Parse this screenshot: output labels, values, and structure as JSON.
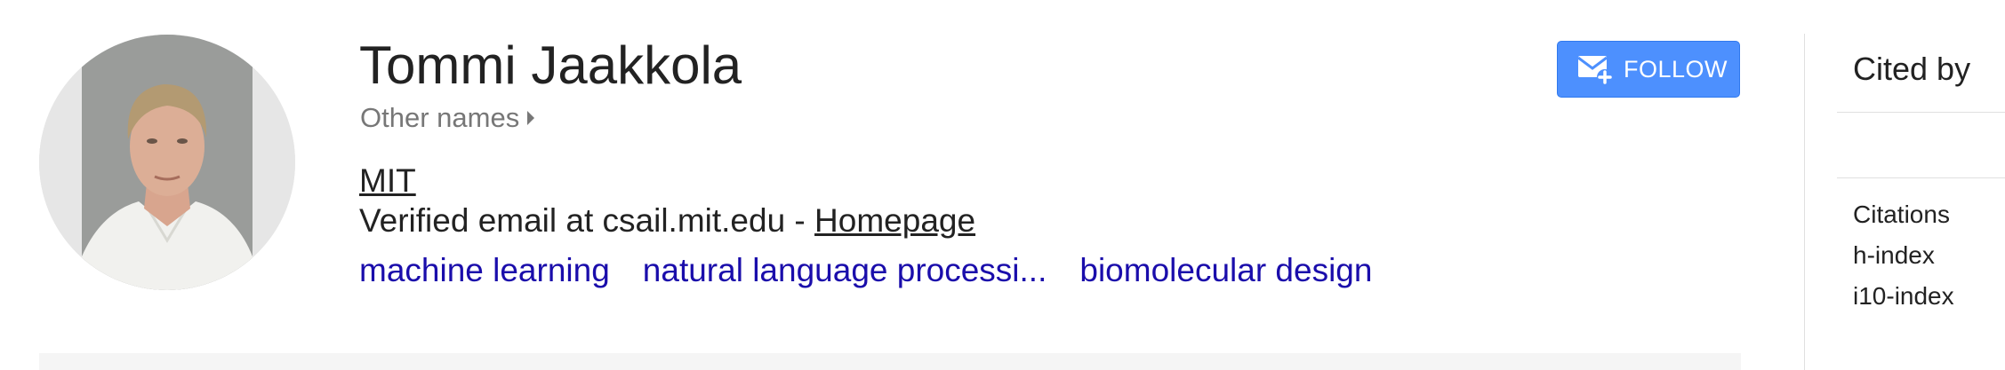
{
  "profile": {
    "name": "Tommi Jaakkola",
    "other_names": "Other names",
    "affiliation": "MIT",
    "email_text": "Verified email at csail.mit.edu - ",
    "homepage": "Homepage",
    "interests": [
      "machine learning",
      "natural language processi...",
      "biomolecular design"
    ]
  },
  "follow": {
    "label": "FOLLOW",
    "icon": "mail-plus-icon",
    "color": "#4d90fe"
  },
  "cited_by": {
    "title": "Cited by",
    "metrics": [
      "Citations",
      "h-index",
      "i10-index"
    ]
  },
  "colors": {
    "link": "#1a0dab",
    "muted": "#777777",
    "text": "#222222"
  }
}
